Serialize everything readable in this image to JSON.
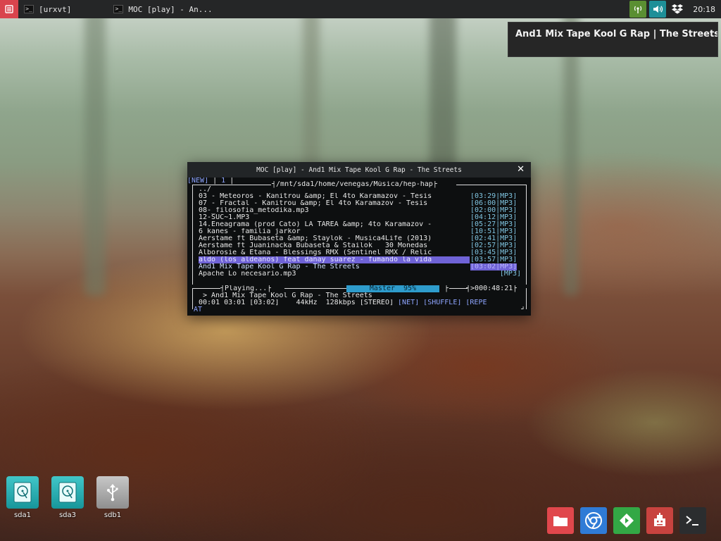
{
  "topbar": {
    "tasks": [
      {
        "label": "[urxvt]"
      },
      {
        "label": "MOC [play] - An..."
      }
    ],
    "clock": "20:18"
  },
  "notification": {
    "text": "And1 Mix Tape Kool G Rap | The Streets"
  },
  "terminal": {
    "title": "MOC [play] - And1 Mix Tape Kool G Rap - The Streets",
    "tabs_line": {
      "new": "[NEW]",
      "sep": " | ",
      "num": "1",
      "tail": " |"
    },
    "path": "/mnt/sda1/home/venegas/Música/hep-hap",
    "parent": "../",
    "files": [
      {
        "name": "03 - Meteoros - Kanitrou &amp; El 4to Karamazov - Tesis",
        "time": "[03:29|MP3]"
      },
      {
        "name": "07 - Fractal - Kanitrou &amp; El 4to Karamazov - Tesis",
        "time": "[06:00|MP3]"
      },
      {
        "name": "08-_filosofia_metodika.mp3",
        "time": "[02:00|MP3]"
      },
      {
        "name": "12-SUC~1.MP3",
        "time": "[04:12|MP3]"
      },
      {
        "name": "14.Eneagrama (prod Cato) LA TAREA &amp; 4to Karamazov -",
        "time": "[05:27|MP3]"
      },
      {
        "name": "6 kanes - familia jarkor",
        "time": "[10:51|MP3]"
      },
      {
        "name": "Aerstame ft Bubaseta &amp; Staylok - Musica4Life (2013)",
        "time": "[02:41|MP3]"
      },
      {
        "name": "Aerstame ft Juaninacka Bubaseta & Stailok   30 Monedas",
        "time": "[02:57|MP3]"
      },
      {
        "name": "Alborosie & Etana - Blessings RMX (Sentinel RMX / Relic",
        "time": "[03:45|MP3]"
      },
      {
        "name": "aldo (los aldeanos) feat danay suarez - fumando la vida",
        "time": "[03:57|MP3]"
      },
      {
        "name": "And1 Mix Tape Kool G Rap - The Streets",
        "time": "[03:02|MP3]"
      },
      {
        "name": "Apache Lo necesario.mp3",
        "time": "[MP3]"
      }
    ],
    "status": {
      "state": "Playing...",
      "mixer": "Master  95%",
      "mixer_level": 0.95,
      "total": ">000:48:21",
      "now_playing": "> And1 Mix Tape Kool G Rap - The Streets",
      "timing": "00:01 03:01 [03:02]",
      "rate": "44kHz",
      "bitrate": "128kbps",
      "stereo": "[STEREO]",
      "net": "[NET]",
      "shuffle": "[SHUFFLE]",
      "repeat": "[REPE",
      "repeat_wrap": "AT"
    }
  },
  "desktop_icons": [
    {
      "label": "sda1"
    },
    {
      "label": "sda3"
    },
    {
      "label": "sdb1"
    }
  ],
  "colors": {
    "panel": "#252627",
    "menu": "#d9444d",
    "highlight": "#6f63d6",
    "tag_blue": "#8ea5ff",
    "mixer": "#2e9ccc"
  }
}
